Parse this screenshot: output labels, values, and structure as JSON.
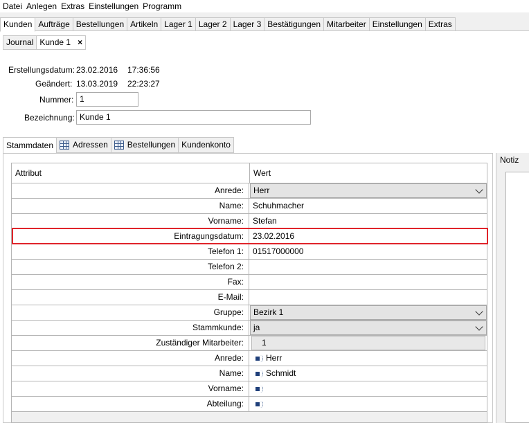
{
  "menu": [
    "Datei",
    "Anlegen",
    "Extras",
    "Einstellungen",
    "Programm"
  ],
  "main_tabs": [
    "Kunden",
    "Aufträge",
    "Bestellungen",
    "Artikeln",
    "Lager 1",
    "Lager 2",
    "Lager 3",
    "Bestätigungen",
    "Mitarbeiter",
    "Einstellungen",
    "Extras"
  ],
  "sub_tabs": {
    "journal": "Journal",
    "kunde": "Kunde 1",
    "close": "×"
  },
  "meta": {
    "erstellung_label": "Erstellungsdatum:",
    "erstellung_date": "23.02.2016",
    "erstellung_time": "17:36:56",
    "geaendert_label": "Geändert:",
    "geaendert_date": "13.03.2019",
    "geaendert_time": "22:23:27",
    "nummer_label": "Nummer:",
    "nummer_value": "1",
    "bezeichnung_label": "Bezeichnung:",
    "bezeichnung_value": "Kunde 1"
  },
  "inner_tabs": [
    "Stammdaten",
    "Adressen",
    "Bestellungen",
    "Kundenkonto"
  ],
  "table": {
    "col_attr": "Attribut",
    "col_val": "Wert",
    "rows": [
      {
        "attr": "Anrede:",
        "val": "Herr",
        "kind": "combo"
      },
      {
        "attr": "Name:",
        "val": "Schuhmacher",
        "kind": "text"
      },
      {
        "attr": "Vorname:",
        "val": "Stefan",
        "kind": "text"
      },
      {
        "attr": "Eintragungsdatum:",
        "val": "23.02.2016",
        "kind": "text"
      },
      {
        "attr": "Telefon 1:",
        "val": "01517000000",
        "kind": "text"
      },
      {
        "attr": "Telefon 2:",
        "val": "",
        "kind": "text"
      },
      {
        "attr": "Fax:",
        "val": "",
        "kind": "text"
      },
      {
        "attr": "E-Mail:",
        "val": "",
        "kind": "text"
      },
      {
        "attr": "Gruppe:",
        "val": "Bezirk 1",
        "kind": "combo"
      },
      {
        "attr": "Stammkunde:",
        "val": "ja",
        "kind": "combo"
      },
      {
        "attr": "Zuständiger Mitarbeiter:",
        "val": "1",
        "kind": "readonly"
      },
      {
        "attr": "Anrede:",
        "val": "Herr",
        "kind": "link"
      },
      {
        "attr": "Name:",
        "val": "Schmidt",
        "kind": "link"
      },
      {
        "attr": "Vorname:",
        "val": "",
        "kind": "link"
      },
      {
        "attr": "Abteilung:",
        "val": "",
        "kind": "link"
      }
    ]
  },
  "notiz_label": "Notiz",
  "colors": {
    "highlight": "#e0242a",
    "icon_blue": "#1f3f7a"
  }
}
